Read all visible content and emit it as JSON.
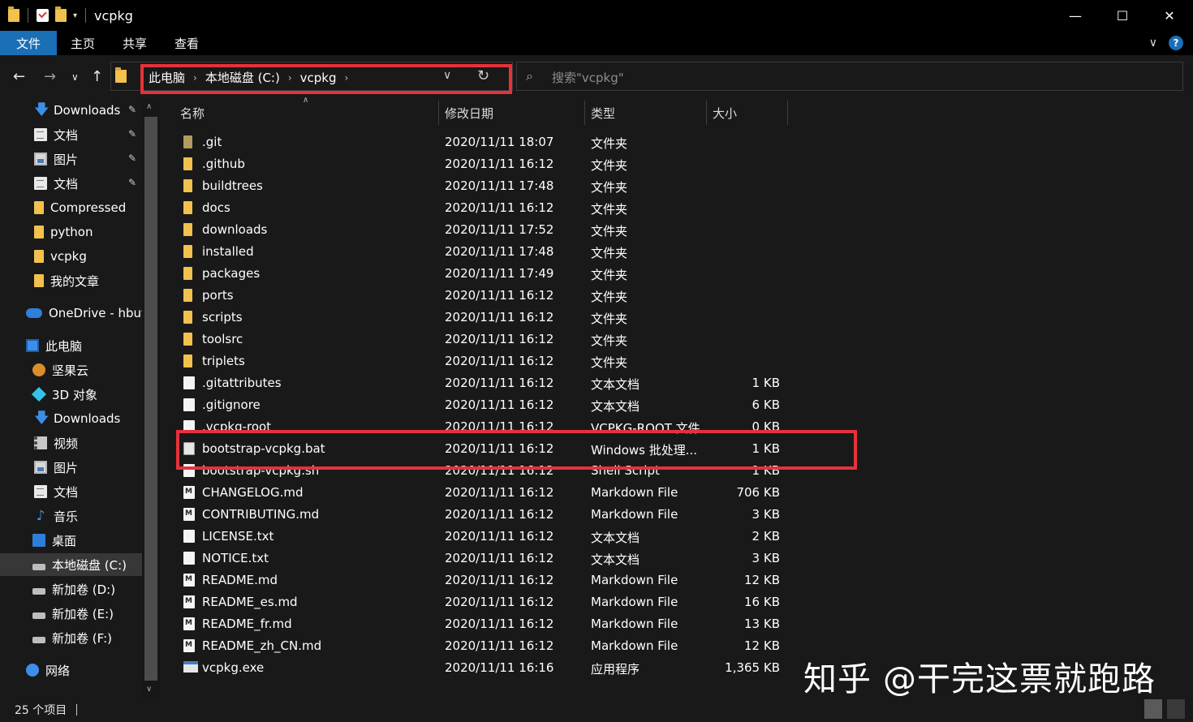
{
  "window": {
    "title": "vcpkg",
    "minimize": "—",
    "maximize": "☐",
    "close": "✕"
  },
  "ribbon": {
    "tabs": [
      "文件",
      "主页",
      "共享",
      "查看"
    ],
    "expand": "∨",
    "help": "?"
  },
  "nav": {
    "back": "←",
    "forward": "→",
    "recent": "∨",
    "up": "↑",
    "breadcrumbs": [
      "此电脑",
      "本地磁盘 (C:)",
      "vcpkg"
    ],
    "crumb_sep": "›",
    "dropdown": "∨",
    "refresh": "↻",
    "search_placeholder": "搜索\"vcpkg\""
  },
  "sidebar": {
    "items": [
      {
        "label": "Downloads",
        "icon": "download-icon",
        "pinned": true
      },
      {
        "label": "文档",
        "icon": "document-icon",
        "pinned": true
      },
      {
        "label": "图片",
        "icon": "pictures-icon",
        "pinned": true
      },
      {
        "label": "文档",
        "icon": "document-icon",
        "pinned": true
      },
      {
        "label": "Compressed",
        "icon": "folder-icon",
        "pinned": false
      },
      {
        "label": "python",
        "icon": "folder-icon",
        "pinned": false
      },
      {
        "label": "vcpkg",
        "icon": "folder-icon",
        "pinned": false
      },
      {
        "label": "我的文章",
        "icon": "folder-icon",
        "pinned": false
      },
      {
        "label": "OneDrive - hbut.",
        "icon": "onedrive-icon",
        "pinned": false
      },
      {
        "label": "此电脑",
        "icon": "computer-icon",
        "pinned": false
      },
      {
        "label": "坚果云",
        "icon": "nutstore-icon",
        "pinned": false
      },
      {
        "label": "3D 对象",
        "icon": "3d-objects-icon",
        "pinned": false
      },
      {
        "label": "Downloads",
        "icon": "download-icon",
        "pinned": false
      },
      {
        "label": "视频",
        "icon": "video-icon",
        "pinned": false
      },
      {
        "label": "图片",
        "icon": "pictures-icon",
        "pinned": false
      },
      {
        "label": "文档",
        "icon": "document-icon",
        "pinned": false
      },
      {
        "label": "音乐",
        "icon": "music-icon",
        "pinned": false
      },
      {
        "label": "桌面",
        "icon": "desktop-icon",
        "pinned": false
      },
      {
        "label": "本地磁盘 (C:)",
        "icon": "drive-icon",
        "pinned": false,
        "active": true
      },
      {
        "label": "新加卷 (D:)",
        "icon": "drive-icon",
        "pinned": false
      },
      {
        "label": "新加卷 (E:)",
        "icon": "drive-icon",
        "pinned": false
      },
      {
        "label": "新加卷 (F:)",
        "icon": "drive-icon",
        "pinned": false
      },
      {
        "label": "网络",
        "icon": "network-icon",
        "pinned": false
      }
    ],
    "pin_glyph": "📌"
  },
  "columns": [
    "名称",
    "修改日期",
    "类型",
    "大小"
  ],
  "files": [
    {
      "name": ".git",
      "date": "2020/11/11 18:07",
      "type": "文件夹",
      "size": "",
      "kind": "folder-git"
    },
    {
      "name": ".github",
      "date": "2020/11/11 16:12",
      "type": "文件夹",
      "size": "",
      "kind": "folder"
    },
    {
      "name": "buildtrees",
      "date": "2020/11/11 17:48",
      "type": "文件夹",
      "size": "",
      "kind": "folder"
    },
    {
      "name": "docs",
      "date": "2020/11/11 16:12",
      "type": "文件夹",
      "size": "",
      "kind": "folder"
    },
    {
      "name": "downloads",
      "date": "2020/11/11 17:52",
      "type": "文件夹",
      "size": "",
      "kind": "folder"
    },
    {
      "name": "installed",
      "date": "2020/11/11 17:48",
      "type": "文件夹",
      "size": "",
      "kind": "folder"
    },
    {
      "name": "packages",
      "date": "2020/11/11 17:49",
      "type": "文件夹",
      "size": "",
      "kind": "folder"
    },
    {
      "name": "ports",
      "date": "2020/11/11 16:12",
      "type": "文件夹",
      "size": "",
      "kind": "folder"
    },
    {
      "name": "scripts",
      "date": "2020/11/11 16:12",
      "type": "文件夹",
      "size": "",
      "kind": "folder"
    },
    {
      "name": "toolsrc",
      "date": "2020/11/11 16:12",
      "type": "文件夹",
      "size": "",
      "kind": "folder"
    },
    {
      "name": "triplets",
      "date": "2020/11/11 16:12",
      "type": "文件夹",
      "size": "",
      "kind": "folder"
    },
    {
      "name": ".gitattributes",
      "date": "2020/11/11 16:12",
      "type": "文本文档",
      "size": "1 KB",
      "kind": "file"
    },
    {
      "name": ".gitignore",
      "date": "2020/11/11 16:12",
      "type": "文本文档",
      "size": "6 KB",
      "kind": "file"
    },
    {
      "name": ".vcpkg-root",
      "date": "2020/11/11 16:12",
      "type": "VCPKG-ROOT 文件",
      "size": "0 KB",
      "kind": "file"
    },
    {
      "name": "bootstrap-vcpkg.bat",
      "date": "2020/11/11 16:12",
      "type": "Windows 批处理...",
      "size": "1 KB",
      "kind": "bat"
    },
    {
      "name": "bootstrap-vcpkg.sh",
      "date": "2020/11/11 16:12",
      "type": "Shell Script",
      "size": "1 KB",
      "kind": "file"
    },
    {
      "name": "CHANGELOG.md",
      "date": "2020/11/11 16:12",
      "type": "Markdown File",
      "size": "706 KB",
      "kind": "md"
    },
    {
      "name": "CONTRIBUTING.md",
      "date": "2020/11/11 16:12",
      "type": "Markdown File",
      "size": "3 KB",
      "kind": "md"
    },
    {
      "name": "LICENSE.txt",
      "date": "2020/11/11 16:12",
      "type": "文本文档",
      "size": "2 KB",
      "kind": "file"
    },
    {
      "name": "NOTICE.txt",
      "date": "2020/11/11 16:12",
      "type": "文本文档",
      "size": "3 KB",
      "kind": "file"
    },
    {
      "name": "README.md",
      "date": "2020/11/11 16:12",
      "type": "Markdown File",
      "size": "12 KB",
      "kind": "md"
    },
    {
      "name": "README_es.md",
      "date": "2020/11/11 16:12",
      "type": "Markdown File",
      "size": "16 KB",
      "kind": "md"
    },
    {
      "name": "README_fr.md",
      "date": "2020/11/11 16:12",
      "type": "Markdown File",
      "size": "13 KB",
      "kind": "md"
    },
    {
      "name": "README_zh_CN.md",
      "date": "2020/11/11 16:12",
      "type": "Markdown File",
      "size": "12 KB",
      "kind": "md"
    },
    {
      "name": "vcpkg.exe",
      "date": "2020/11/11 16:16",
      "type": "应用程序",
      "size": "1,365 KB",
      "kind": "exe"
    }
  ],
  "status": {
    "count": "25 个项目"
  },
  "watermark": "知乎 @干完这票就跑路",
  "colors": {
    "highlight": "#e5323a",
    "accent": "#1a6fb5"
  }
}
